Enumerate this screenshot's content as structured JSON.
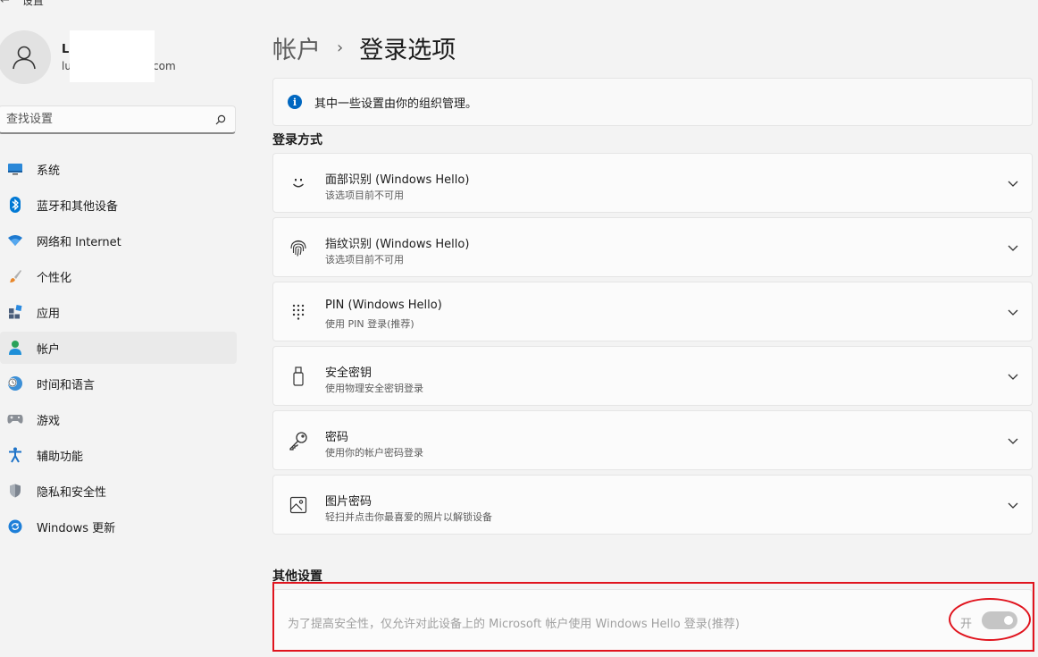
{
  "window": {
    "title": "设置"
  },
  "profile": {
    "name": "L",
    "email_prefix": "lu",
    "email_suffix": "com"
  },
  "search": {
    "placeholder": "查找设置"
  },
  "sidebar": {
    "items": [
      {
        "label": "系统",
        "icon": "monitor-icon"
      },
      {
        "label": "蓝牙和其他设备",
        "icon": "bluetooth-icon"
      },
      {
        "label": "网络和 Internet",
        "icon": "wifi-icon"
      },
      {
        "label": "个性化",
        "icon": "brush-icon"
      },
      {
        "label": "应用",
        "icon": "apps-icon"
      },
      {
        "label": "帐户",
        "icon": "person-icon",
        "active": true
      },
      {
        "label": "时间和语言",
        "icon": "globe-clock-icon"
      },
      {
        "label": "游戏",
        "icon": "gamepad-icon"
      },
      {
        "label": "辅助功能",
        "icon": "accessibility-icon"
      },
      {
        "label": "隐私和安全性",
        "icon": "shield-icon"
      },
      {
        "label": "Windows 更新",
        "icon": "update-icon"
      }
    ]
  },
  "breadcrumb": {
    "parent": "帐户",
    "separator": "›",
    "current": "登录选项"
  },
  "info_banner": {
    "text": "其中一些设置由你的组织管理。",
    "icon": "info-icon"
  },
  "signin_section": {
    "title": "登录方式",
    "options": [
      {
        "title": "面部识别 (Windows Hello)",
        "subtitle": "该选项目前不可用",
        "icon": "face-icon"
      },
      {
        "title": "指纹识别 (Windows Hello)",
        "subtitle": "该选项目前不可用",
        "icon": "fingerprint-icon"
      },
      {
        "title": "PIN (Windows Hello)",
        "subtitle": "使用 PIN 登录(推荐)",
        "icon": "pin-keypad-icon"
      },
      {
        "title": "安全密钥",
        "subtitle": "使用物理安全密钥登录",
        "icon": "usb-key-icon"
      },
      {
        "title": "密码",
        "subtitle": "使用你的帐户密码登录",
        "icon": "key-icon"
      },
      {
        "title": "图片密码",
        "subtitle": "轻扫并点击你最喜爱的照片以解锁设备",
        "icon": "picture-icon"
      }
    ]
  },
  "other_section": {
    "title": "其他设置",
    "setting": {
      "text": "为了提高安全性，仅允许对此设备上的 Microsoft 帐户使用 Windows Hello 登录(推荐)",
      "state_label": "开",
      "toggle_on": true,
      "disabled": true
    }
  },
  "colors": {
    "accent": "#0067c0",
    "annotation": "#e0141e",
    "background": "#f3f3f3"
  }
}
